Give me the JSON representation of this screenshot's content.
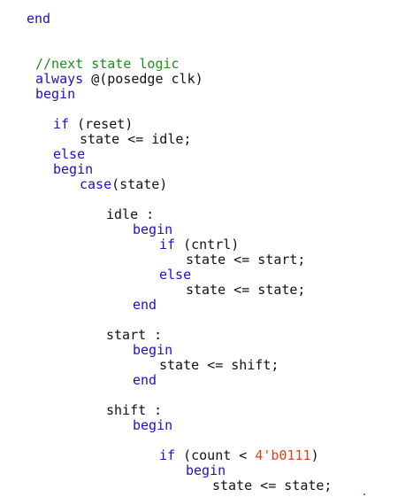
{
  "editor": {
    "colors": {
      "keyword": "#1d10c8",
      "text": "#111111",
      "comment": "#1e8c1e",
      "number": "#e0401a",
      "background": "#ffffff"
    },
    "lines": [
      {
        "tokens": [
          {
            "t": "kw",
            "v": "end"
          }
        ]
      },
      {
        "tokens": [
          {
            "t": "cm",
            "v": "//next state logic"
          }
        ]
      },
      {
        "tokens": [
          {
            "t": "kw",
            "v": "always"
          },
          {
            "t": "tx",
            "v": " @(posedge clk)"
          }
        ]
      },
      {
        "tokens": [
          {
            "t": "kw",
            "v": "begin"
          }
        ]
      },
      {
        "tokens": [
          {
            "t": "kw",
            "v": "if"
          },
          {
            "t": "tx",
            "v": " (reset)"
          }
        ]
      },
      {
        "tokens": [
          {
            "t": "tx",
            "v": "state <= idle;"
          }
        ]
      },
      {
        "tokens": [
          {
            "t": "kw",
            "v": "else"
          }
        ]
      },
      {
        "tokens": [
          {
            "t": "kw",
            "v": "begin"
          }
        ]
      },
      {
        "tokens": [
          {
            "t": "kw",
            "v": "case"
          },
          {
            "t": "tx",
            "v": "(state)"
          }
        ]
      },
      {
        "tokens": [
          {
            "t": "tx",
            "v": "idle :"
          }
        ]
      },
      {
        "tokens": [
          {
            "t": "kw",
            "v": "begin"
          }
        ]
      },
      {
        "tokens": [
          {
            "t": "kw",
            "v": "if"
          },
          {
            "t": "tx",
            "v": " (cntrl)"
          }
        ]
      },
      {
        "tokens": [
          {
            "t": "tx",
            "v": "state <= start;"
          }
        ]
      },
      {
        "tokens": [
          {
            "t": "kw",
            "v": "else"
          }
        ]
      },
      {
        "tokens": [
          {
            "t": "tx",
            "v": "state <= state;"
          }
        ]
      },
      {
        "tokens": [
          {
            "t": "kw",
            "v": "end"
          }
        ]
      },
      {
        "tokens": [
          {
            "t": "tx",
            "v": "start :"
          }
        ]
      },
      {
        "tokens": [
          {
            "t": "kw",
            "v": "begin"
          }
        ]
      },
      {
        "tokens": [
          {
            "t": "tx",
            "v": "state <= shift;"
          }
        ]
      },
      {
        "tokens": [
          {
            "t": "kw",
            "v": "end"
          }
        ]
      },
      {
        "tokens": [
          {
            "t": "tx",
            "v": "shift :"
          }
        ]
      },
      {
        "tokens": [
          {
            "t": "kw",
            "v": "begin"
          }
        ]
      },
      {
        "tokens": [
          {
            "t": "kw",
            "v": "if"
          },
          {
            "t": "tx",
            "v": " (count < "
          },
          {
            "t": "nm",
            "v": "4'b0111"
          },
          {
            "t": "tx",
            "v": ")"
          }
        ]
      },
      {
        "tokens": [
          {
            "t": "kw",
            "v": "begin"
          }
        ]
      },
      {
        "tokens": [
          {
            "t": "tx",
            "v": "state <= state;"
          }
        ]
      }
    ]
  }
}
